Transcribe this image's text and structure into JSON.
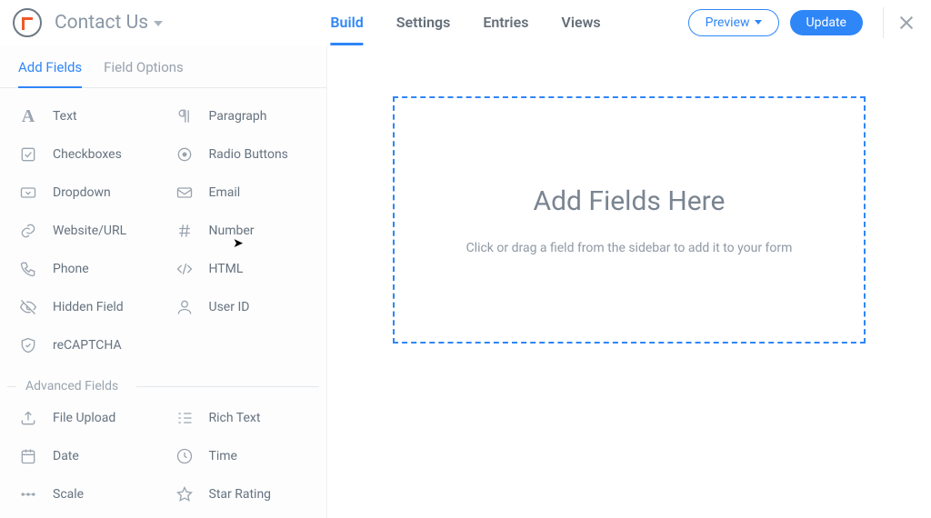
{
  "header": {
    "formTitle": "Contact Us",
    "nav": {
      "build": "Build",
      "settings": "Settings",
      "entries": "Entries",
      "views": "Views"
    },
    "previewLabel": "Preview",
    "updateLabel": "Update"
  },
  "sidebar": {
    "tabs": {
      "addFields": "Add Fields",
      "fieldOptions": "Field Options"
    },
    "basic": {
      "text": "Text",
      "paragraph": "Paragraph",
      "checkboxes": "Checkboxes",
      "radio": "Radio Buttons",
      "dropdown": "Dropdown",
      "email": "Email",
      "website": "Website/URL",
      "number": "Number",
      "phone": "Phone",
      "html": "HTML",
      "hidden": "Hidden Field",
      "userId": "User ID",
      "recaptcha": "reCAPTCHA"
    },
    "advancedHeader": "Advanced Fields",
    "advanced": {
      "file": "File Upload",
      "rich": "Rich Text",
      "date": "Date",
      "time": "Time",
      "scale": "Scale",
      "star": "Star Rating"
    }
  },
  "canvas": {
    "title": "Add Fields Here",
    "hint": "Click or drag a field from the sidebar to add it to your form"
  }
}
